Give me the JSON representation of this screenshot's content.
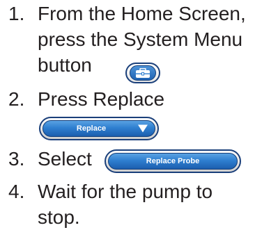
{
  "steps": [
    {
      "number": "1.",
      "lines": [
        "From the Home Screen,",
        "press the System Menu",
        "button"
      ]
    },
    {
      "number": "2.",
      "lines": [
        "Press Replace"
      ]
    },
    {
      "number": "3.",
      "lines": [
        "Select"
      ]
    },
    {
      "number": "4.",
      "lines": [
        "Wait for the pump to",
        "stop."
      ]
    }
  ],
  "buttons": {
    "system_menu_icon": "toolbox-icon",
    "replace_dropdown_label": "Replace",
    "replace_probe_label": "Replace Probe"
  },
  "colors": {
    "button_blue": "#2f7fd0",
    "button_border": "#1a3f7a",
    "text": "#231f20"
  }
}
